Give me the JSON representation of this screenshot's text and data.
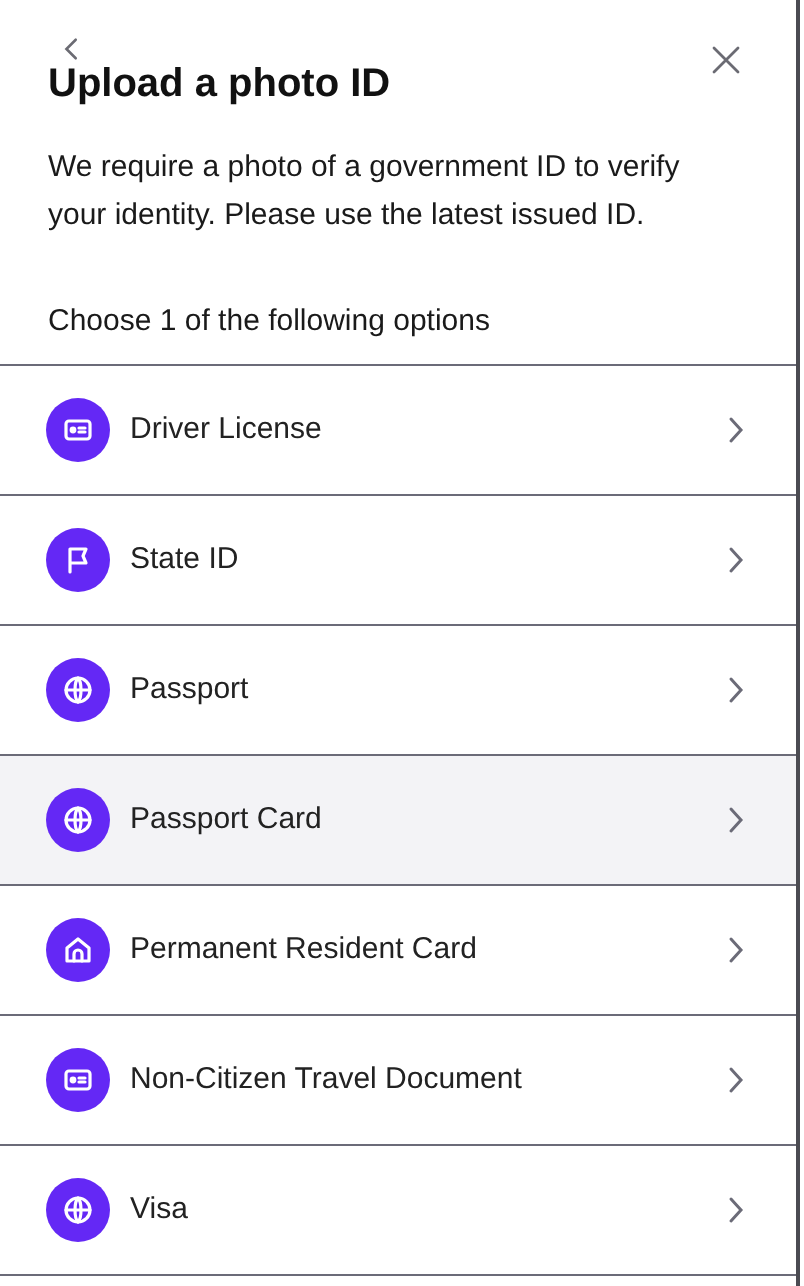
{
  "header": {
    "title": "Upload a photo ID",
    "description": "We require a photo of a government ID to verify your identity. Please use the latest issued ID."
  },
  "prompt": "Choose 1 of the following options",
  "options": [
    {
      "label": "Driver License",
      "kind": "card",
      "selected": false
    },
    {
      "label": "State ID",
      "kind": "flag",
      "selected": false
    },
    {
      "label": "Passport",
      "kind": "globe",
      "selected": false
    },
    {
      "label": "Passport Card",
      "kind": "globe",
      "selected": true
    },
    {
      "label": "Permanent Resident Card",
      "kind": "home",
      "selected": false
    },
    {
      "label": "Non-Citizen Travel Document",
      "kind": "card",
      "selected": false
    },
    {
      "label": "Visa",
      "kind": "globe",
      "selected": false
    }
  ]
}
